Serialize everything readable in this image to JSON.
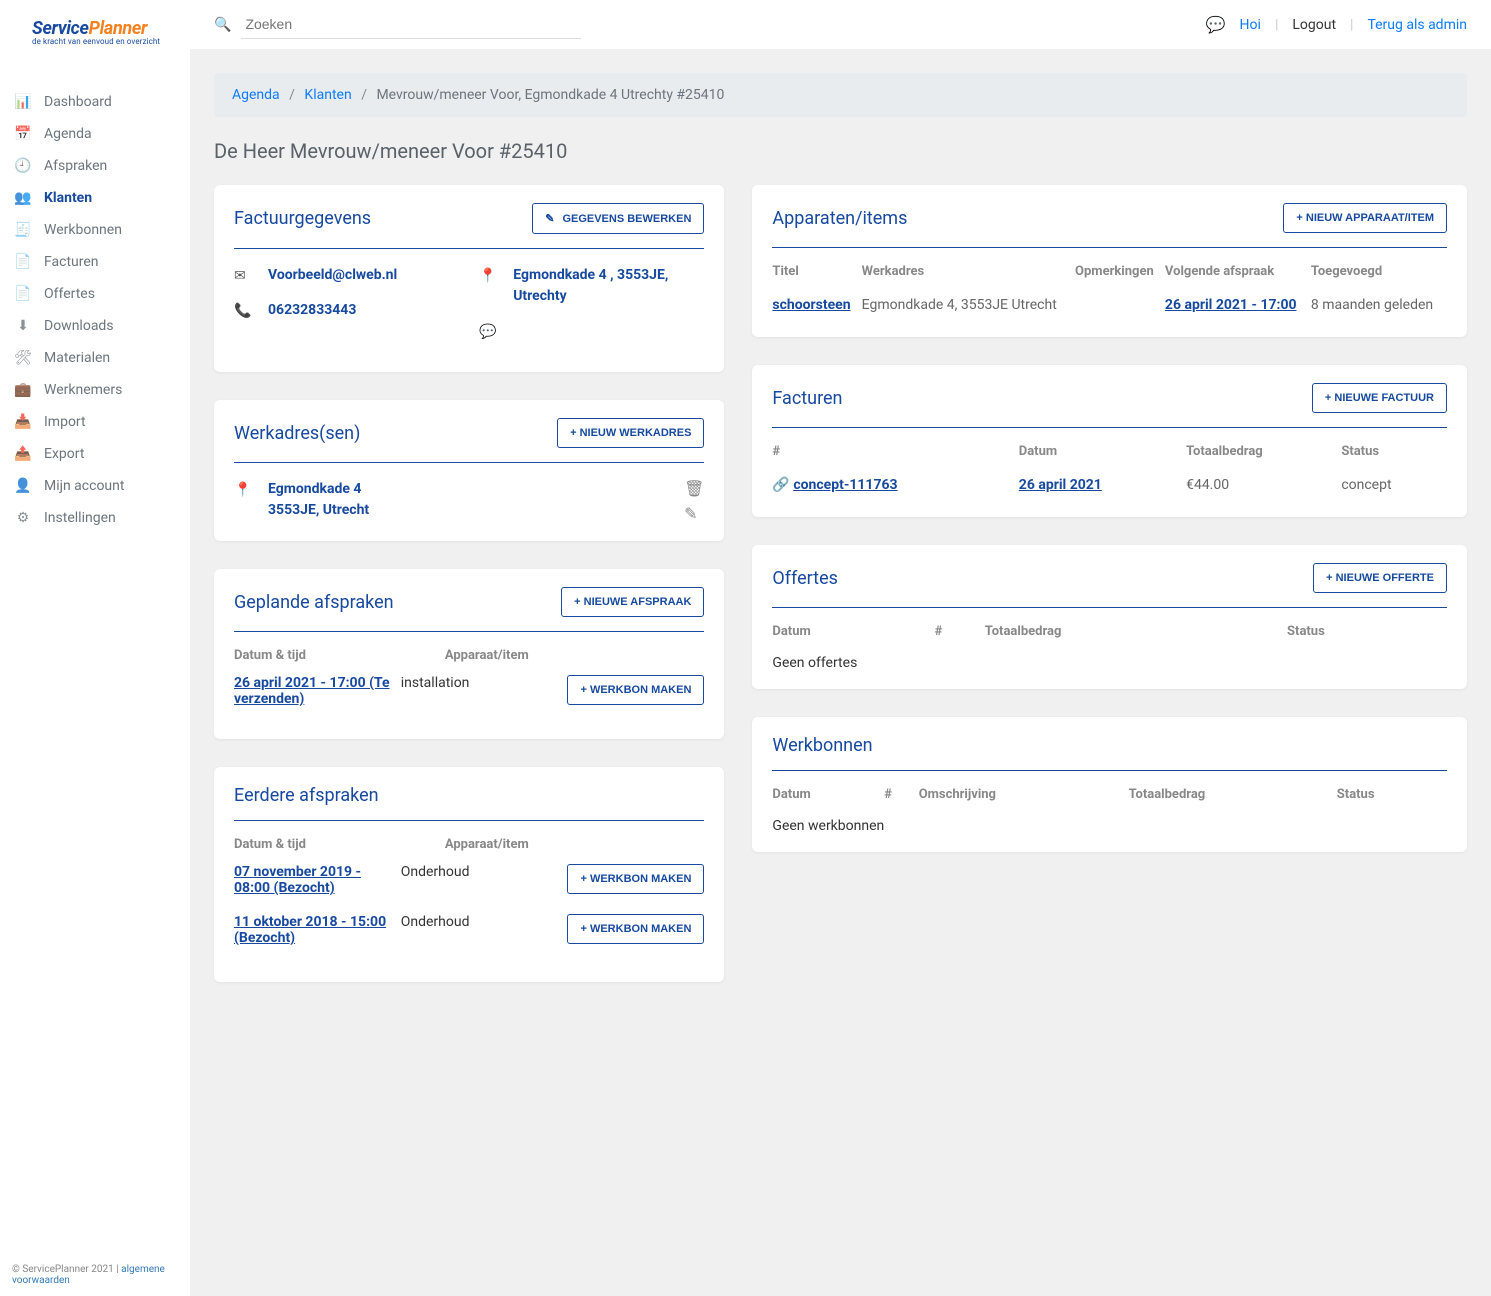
{
  "logo": {
    "part1": "Service",
    "part2": "Planner",
    "tag": "de kracht van eenvoud en overzicht"
  },
  "search": {
    "placeholder": "Zoeken"
  },
  "topbar": {
    "greeting": "Hoi",
    "logout": "Logout",
    "back_as_admin": "Terug als admin"
  },
  "sidebar": {
    "items": [
      {
        "label": "Dashboard",
        "icon": "📊"
      },
      {
        "label": "Agenda",
        "icon": "📅"
      },
      {
        "label": "Afspraken",
        "icon": "🕘"
      },
      {
        "label": "Klanten",
        "icon": "👥",
        "active": true
      },
      {
        "label": "Werkbonnen",
        "icon": "🧾"
      },
      {
        "label": "Facturen",
        "icon": "📄"
      },
      {
        "label": "Offertes",
        "icon": "📄"
      },
      {
        "label": "Downloads",
        "icon": "⬇"
      },
      {
        "label": "Materialen",
        "icon": "🛠"
      },
      {
        "label": "Werknemers",
        "icon": "💼"
      },
      {
        "label": "Import",
        "icon": "📥"
      },
      {
        "label": "Export",
        "icon": "📤"
      },
      {
        "label": "Mijn account",
        "icon": "👤"
      },
      {
        "label": "Instellingen",
        "icon": "⚙"
      }
    ]
  },
  "footer": {
    "copyright": "© ServicePlanner 2021 | ",
    "terms_label": "algemene voorwaarden"
  },
  "breadcrumb": {
    "items": [
      "Agenda",
      "Klanten"
    ],
    "current": "Mevrouw/meneer Voor, Egmondkade 4 Utrechty #25410"
  },
  "page_title": "De Heer Mevrouw/meneer Voor #25410",
  "invoice_data": {
    "title": "Factuurgegevens",
    "edit_btn": "GEGEVENS BEWERKEN",
    "email": "Voorbeeld@clweb.nl",
    "phone": "06232833443",
    "address": "Egmondkade 4 , 3553JE, Utrechty"
  },
  "devices": {
    "title": "Apparaten/items",
    "add_btn": "+ NIEUW APPARAAT/ITEM",
    "columns": {
      "title": "Titel",
      "work_address": "Werkadres",
      "notes": "Opmerkingen",
      "next": "Volgende afspraak",
      "added": "Toegevoegd"
    },
    "rows": [
      {
        "title": "schoorsteen",
        "work_address": "Egmondkade 4, 3553JE Utrecht",
        "next": "26 april 2021 - 17:00",
        "added": "8 maanden geleden"
      }
    ]
  },
  "work_addresses": {
    "title": "Werkadres(sen)",
    "add_btn": "+ NIEUW WERKADRES",
    "items": [
      {
        "line1": "Egmondkade 4",
        "line2": "3553JE, Utrecht"
      }
    ]
  },
  "invoices": {
    "title": "Facturen",
    "add_btn": "+ NIEUWE FACTUUR",
    "columns": {
      "num": "#",
      "date": "Datum",
      "total": "Totaalbedrag",
      "status": "Status"
    },
    "rows": [
      {
        "num": "concept-111763",
        "date": "26 april 2021",
        "total": "€44.00",
        "status": "concept"
      }
    ]
  },
  "planned": {
    "title": "Geplande afspraken",
    "add_btn": "+ NIEUWE AFSPRAAK",
    "columns": {
      "datetime": "Datum & tijd",
      "device": "Apparaat/item"
    },
    "workorder_btn": "+ WERKBON MAKEN",
    "rows": [
      {
        "datetime": "26 april 2021 - 17:00 (Te verzenden)",
        "device": "installation"
      }
    ]
  },
  "quotes": {
    "title": "Offertes",
    "add_btn": "+ NIEUWE OFFERTE",
    "columns": {
      "date": "Datum",
      "num": "#",
      "total": "Totaalbedrag",
      "status": "Status"
    },
    "empty": "Geen offertes"
  },
  "past": {
    "title": "Eerdere afspraken",
    "columns": {
      "datetime": "Datum & tijd",
      "device": "Apparaat/item"
    },
    "workorder_btn": "+ WERKBON MAKEN",
    "rows": [
      {
        "datetime": "07 november 2019 - 08:00 (Bezocht)",
        "device": "Onderhoud"
      },
      {
        "datetime": "11 oktober 2018 - 15:00 (Bezocht)",
        "device": "Onderhoud"
      }
    ]
  },
  "workorders": {
    "title": "Werkbonnen",
    "columns": {
      "date": "Datum",
      "num": "#",
      "desc": "Omschrijving",
      "total": "Totaalbedrag",
      "status": "Status"
    },
    "empty": "Geen werkbonnen"
  }
}
